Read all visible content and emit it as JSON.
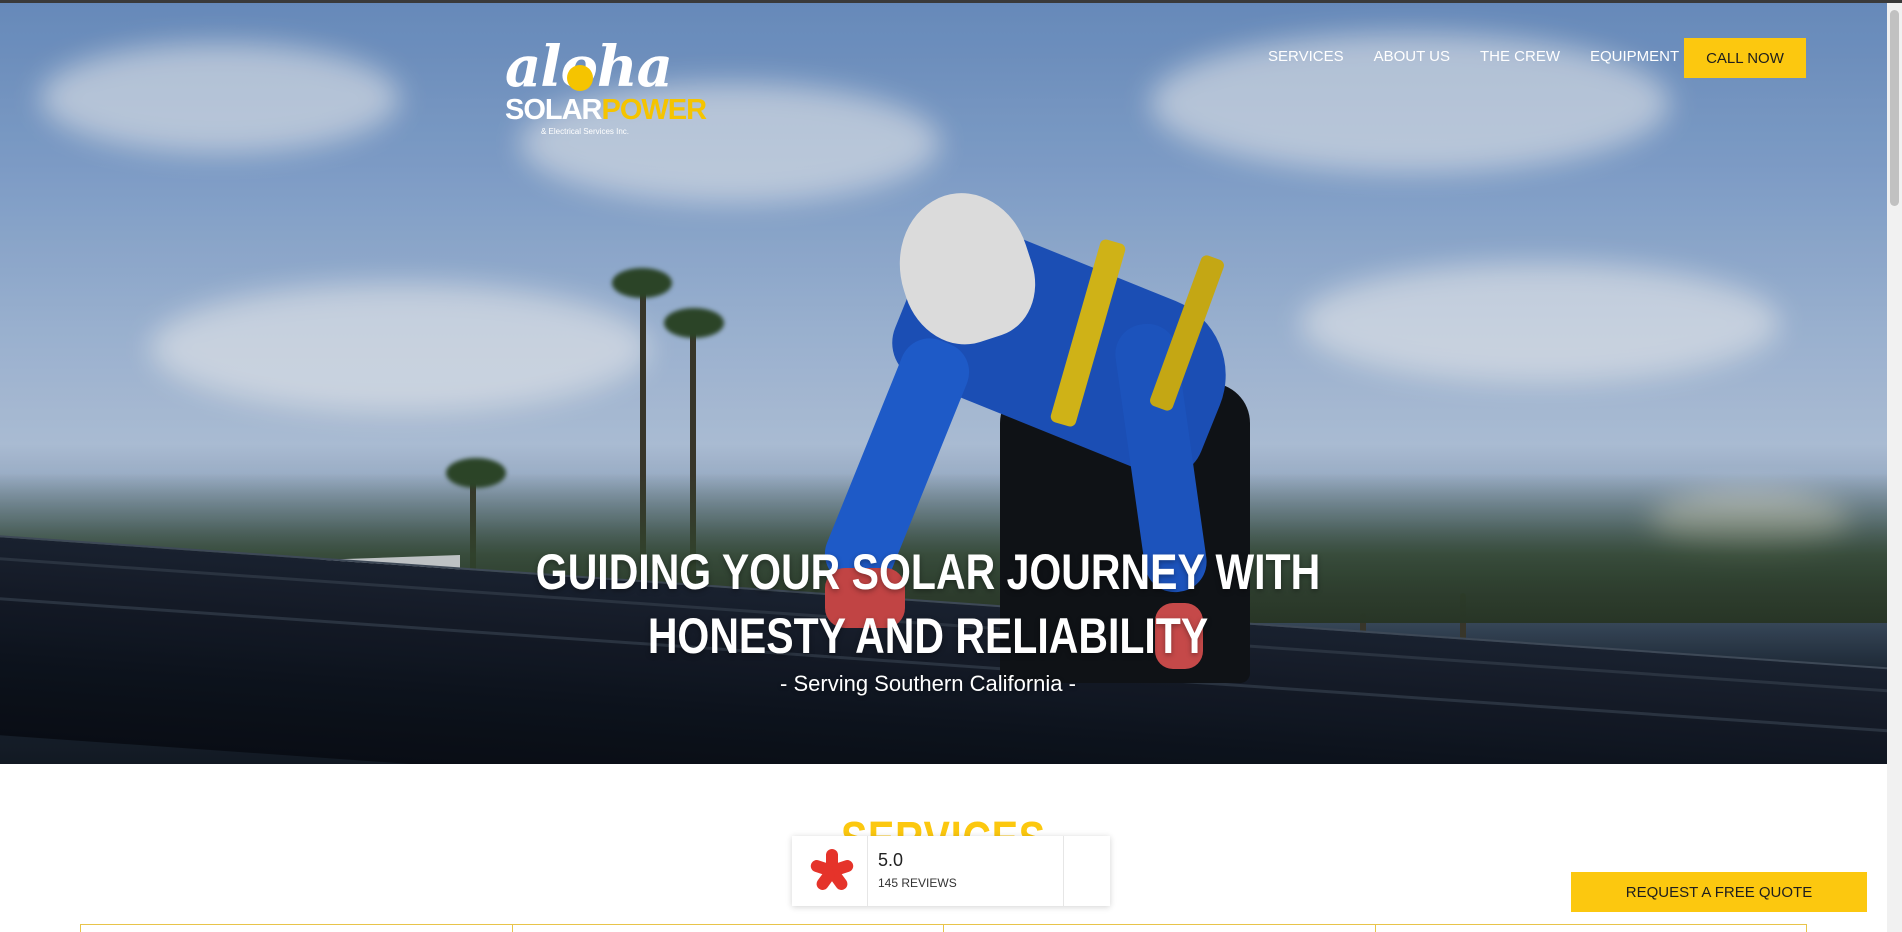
{
  "logo": {
    "script_text": "aloha",
    "brand_solar": "SOLAR",
    "brand_power": "POWER",
    "tagline": "& Electrical Services Inc.",
    "accent_color": "#fcc80f"
  },
  "nav": {
    "items": [
      {
        "label": "SERVICES"
      },
      {
        "label": "ABOUT US"
      },
      {
        "label": "THE CREW"
      },
      {
        "label": "EQUIPMENT"
      }
    ],
    "cta_label": "CALL NOW"
  },
  "hero": {
    "title_line1": "GUIDING YOUR SOLAR JOURNEY WITH",
    "title_line2": "HONESTY AND RELIABILITY",
    "subtitle": "- Serving Southern California -",
    "image_description_icon": "solar-worker-photo"
  },
  "services": {
    "heading": "SERVICES"
  },
  "yelp_badge": {
    "icon": "yelp-burst-icon",
    "rating": "5.0",
    "reviews": "145 REVIEWS",
    "brand_color": "#e5332a"
  },
  "floating_cta": {
    "label": "REQUEST A FREE QUOTE"
  },
  "colors": {
    "accent": "#fcc80f",
    "text_light": "#ffffff"
  }
}
